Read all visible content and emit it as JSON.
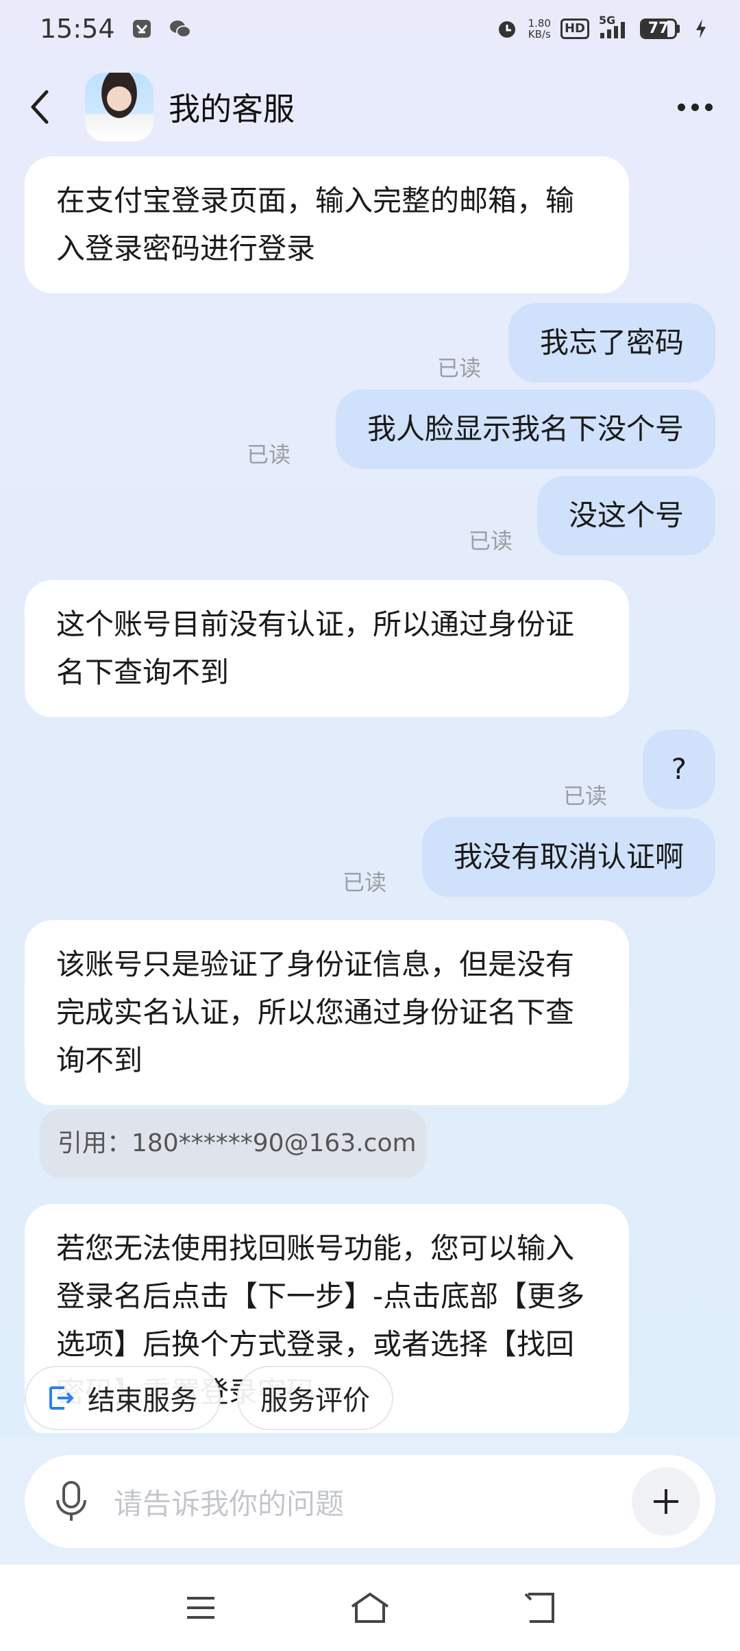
{
  "status_bar": {
    "time": "15:54",
    "net_speed_value": "1.80",
    "net_speed_unit": "KB/s",
    "hd_label": "HD",
    "network_label": "5G",
    "battery_level": "77"
  },
  "header": {
    "title": "我的客服"
  },
  "messages": {
    "m1": "在支付宝登录页面，输入完整的邮箱，输入登录密码进行登录",
    "m2": "我忘了密码",
    "m3": "我人脸显示我名下没个号",
    "m4": "没这个号",
    "m5": "这个账号目前没有认证，所以通过身份证名下查询不到",
    "m6": "?",
    "m7": "我没有取消认证啊",
    "m8": "该账号只是验证了身份证信息，但是没有完成实名认证，所以您通过身份证名下查询不到",
    "quote": "引用：180******90@163.com",
    "m9": "若您无法使用找回账号功能，您可以输入登录名后点击【下一步】-点击底部【更多选项】后换个方式登录，或者选择【找回密码】重置登录密码"
  },
  "read_label": "已读",
  "chips": {
    "end_service": "结束服务",
    "rate_service": "服务评价"
  },
  "input": {
    "placeholder": "请告诉我你的问题"
  },
  "icons": {
    "back": "back-arrow-icon",
    "more": "more-dots-icon",
    "mic": "microphone-icon",
    "plus": "plus-icon",
    "exit": "exit-icon"
  }
}
